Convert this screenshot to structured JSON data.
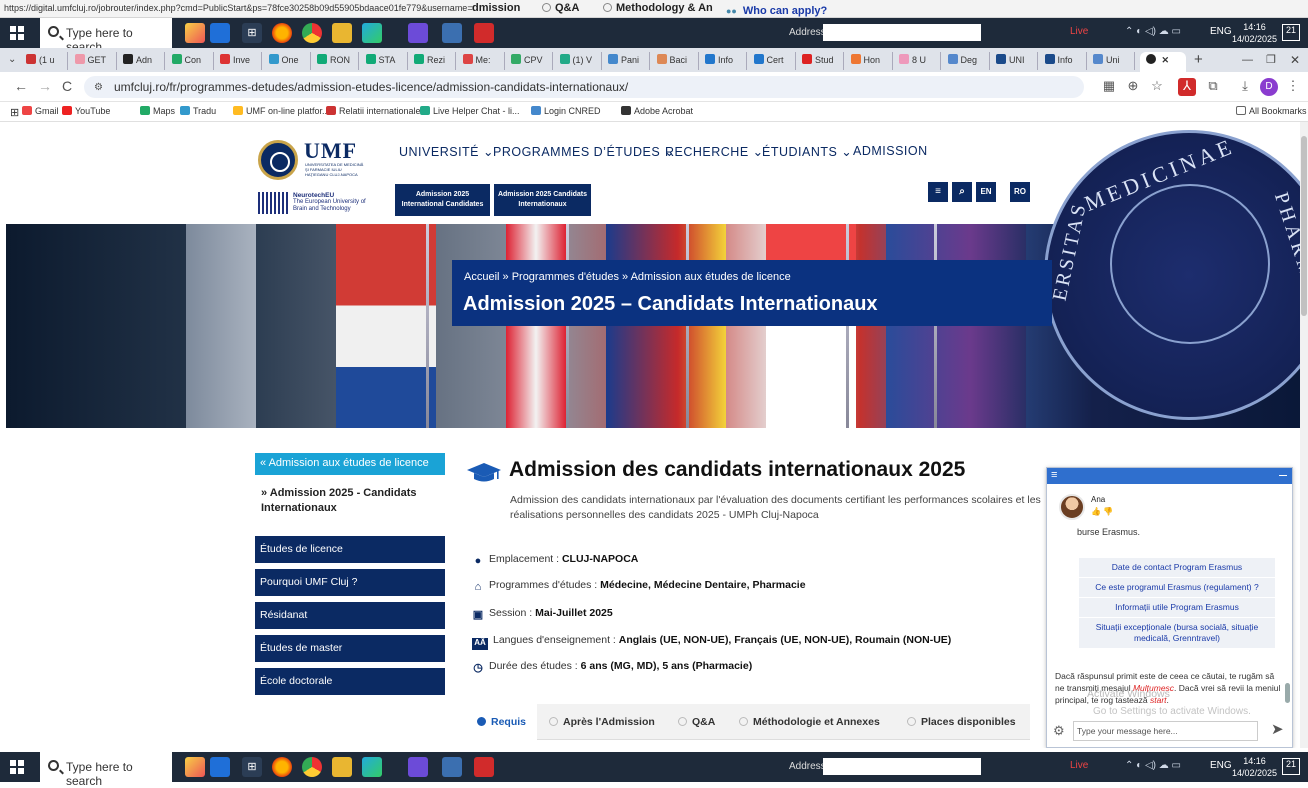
{
  "background_app": {
    "url": "https://digital.umfcluj.ro/jobrouter/index.php?cmd=PublicStart&ps=78fce30258b09d55905bdaace01fe779&username=webuser",
    "tabs": [
      "dmission",
      "Q&A",
      "Methodology & An",
      "Who can apply?"
    ]
  },
  "taskbar": {
    "search_placeholder": "Type here to search",
    "address_label": "Address",
    "live_label": "Live",
    "lang": "ENG",
    "time": "14:16",
    "date": "14/02/2025",
    "notification_count": "21"
  },
  "browser": {
    "tabs": [
      "(1 u",
      "GET",
      "Adn",
      "Con",
      "Inve",
      "One",
      "RON",
      "STA",
      "Rezi",
      "Me:",
      "CPV",
      "(1) V",
      "Pani",
      "Baci",
      "Info",
      "Cert",
      "Stud",
      "Hon",
      "8 U",
      "Deg",
      "UNI",
      "Info",
      "Uni"
    ],
    "active_tab": "",
    "address": "umfcluj.ro/fr/programmes-detudes/admission-etudes-licence/admission-candidats-internationaux/",
    "bookmarks": [
      "Gmail",
      "YouTube",
      "Maps",
      "Tradu",
      "UMF on-line platfor...",
      "Relatii internationale",
      "Live Helper Chat - li...",
      "Login CNRED",
      "Adobe Acrobat"
    ],
    "all_bookmarks": "All Bookmarks",
    "profile_initial": "D"
  },
  "site": {
    "logo": "UMF",
    "logo_sub": "UNIVERSITATEA DE MEDICINĂ ŞI FARMACIE IULIU HAŢIEGANU CLUJ-NAPOCA",
    "neuro_title": "NeurotechEU",
    "neuro_sub": "The European University of Brain and Technology",
    "nav": [
      "UNIVERSITÉ ⌄",
      "PROGRAMMES D’ÉTUDES ⌄",
      "RECHERCHE ⌄",
      "ÉTUDIANTS ⌄",
      "ADMISSION"
    ],
    "admission_btn_1": "Admission 2025 International Candidates",
    "admission_btn_2": "Admission 2025 Candidats Internationaux",
    "lang_en": "EN",
    "lang_ro": "RO",
    "hero": {
      "breadcrumb": "Accueil » Programmes d'études » Admission aux études de licence",
      "title": "Admission 2025 – Candidats Internationaux",
      "seal_text_1": "MEDICINAE",
      "seal_text_2": "PHARMAC",
      "seal_text_3": "ERSITAS"
    },
    "sidebar": {
      "active": "« Admission aux études de licence",
      "current": "» Admission 2025 - Candidats Internationaux",
      "items": [
        "Études de licence",
        "Pourquoi UMF Cluj ?",
        "Résidanat",
        "Études de master",
        "École doctorale"
      ]
    },
    "main": {
      "title": "Admission des candidats internationaux 2025",
      "description": "Admission des candidats internationaux par l'évaluation des documents certifiant les performances scolaires et les réalisations personnelles des candidats 2025 - UMPh Cluj-Napoca",
      "info": [
        {
          "label": "Emplacement : ",
          "value": "CLUJ-NAPOCA"
        },
        {
          "label": "Programmes d'études : ",
          "value": "Médecine, Médecine Dentaire, Pharmacie"
        },
        {
          "label": "Session : ",
          "value": "Mai-Juillet 2025"
        },
        {
          "label": "Langues d'enseignement : ",
          "value": "Anglais (UE, NON-UE), Français (UE, NON-UE), Roumain (NON-UE)"
        },
        {
          "label": "Durée des études : ",
          "value": "6 ans (MG, MD), 5 ans (Pharmacie)"
        }
      ],
      "tabs": [
        "Requis",
        "Après l'Admission",
        "Q&A",
        "Méthodologie et Annexes",
        "Places disponibles"
      ]
    }
  },
  "chat": {
    "agent_name": "Ana",
    "prev_message": "burse Erasmus.",
    "options": [
      "Date de contact Program Erasmus",
      "Ce este programul Erasmus (regulament) ?",
      "Informații utile Program Erasmus",
      "Situații excepționale (bursa socială, situație medicală, Grenntravel)"
    ],
    "message_part1": "Dacă răspunsul primit este de ceea ce căutai, te rugăm să ne transmiți mesajul ",
    "message_highlight1": "Mulțumesc",
    "message_part2": ". Dacă vrei să revii la meniul principal, te rog tastează ",
    "message_highlight2": "start",
    "message_part3": ".",
    "watermark_1": "Activate Windows",
    "watermark_2": "Go to Settings to activate Windows.",
    "input_placeholder": "Type your message here..."
  }
}
